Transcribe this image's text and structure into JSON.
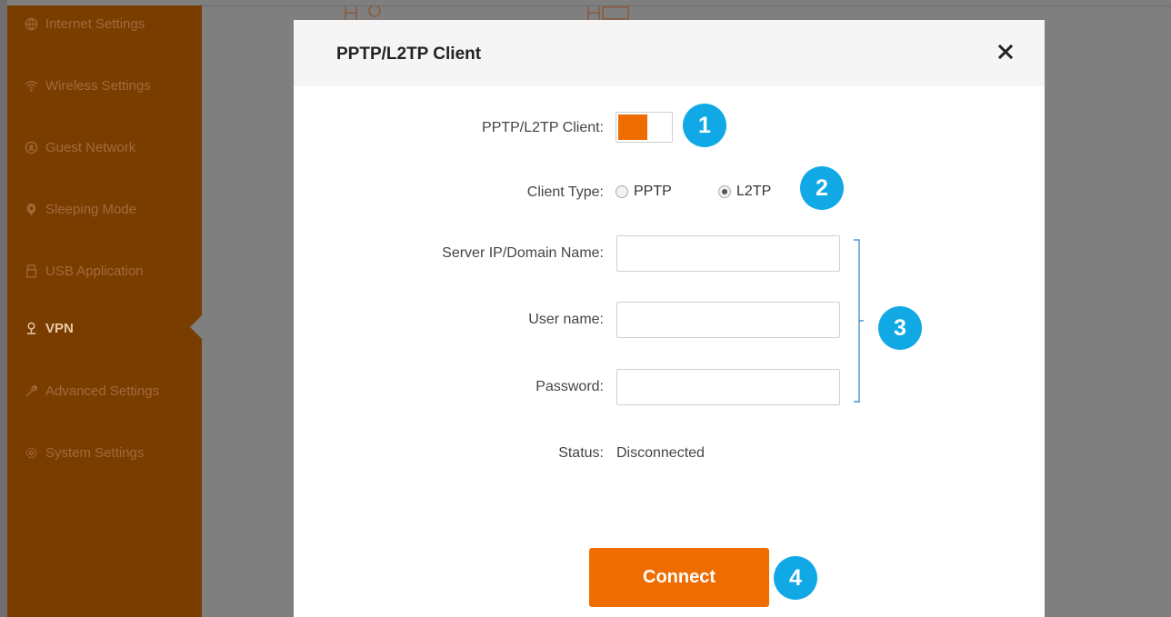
{
  "sidebar": {
    "items": [
      {
        "label": "Internet Settings",
        "icon": "globe-icon"
      },
      {
        "label": "Wireless Settings",
        "icon": "wifi-icon"
      },
      {
        "label": "Guest Network",
        "icon": "guest-icon"
      },
      {
        "label": "Sleeping Mode",
        "icon": "moon-icon"
      },
      {
        "label": "USB Application",
        "icon": "usb-icon"
      },
      {
        "label": "VPN",
        "icon": "vpn-icon",
        "active": true
      },
      {
        "label": "Advanced Settings",
        "icon": "wrench-icon"
      },
      {
        "label": "System Settings",
        "icon": "gear-icon"
      }
    ]
  },
  "modal": {
    "title": "PPTP/L2TP Client",
    "close_icon": "close-icon",
    "client_toggle": {
      "label": "PPTP/L2TP Client:",
      "enabled": true
    },
    "client_type": {
      "label": "Client Type:",
      "options": [
        "PPTP",
        "L2TP"
      ],
      "selected": "L2TP"
    },
    "server": {
      "label": "Server IP/Domain Name:",
      "value": ""
    },
    "username": {
      "label": "User name:",
      "value": ""
    },
    "password": {
      "label": "Password:",
      "value": ""
    },
    "status": {
      "label": "Status:",
      "value": "Disconnected"
    },
    "connect_label": "Connect"
  },
  "callouts": [
    "1",
    "2",
    "3",
    "4"
  ],
  "colors": {
    "accent": "#ef6c00",
    "sidebar": "#7a3d00",
    "callout": "#10a9e6",
    "overlay": "#7f7f7f"
  }
}
